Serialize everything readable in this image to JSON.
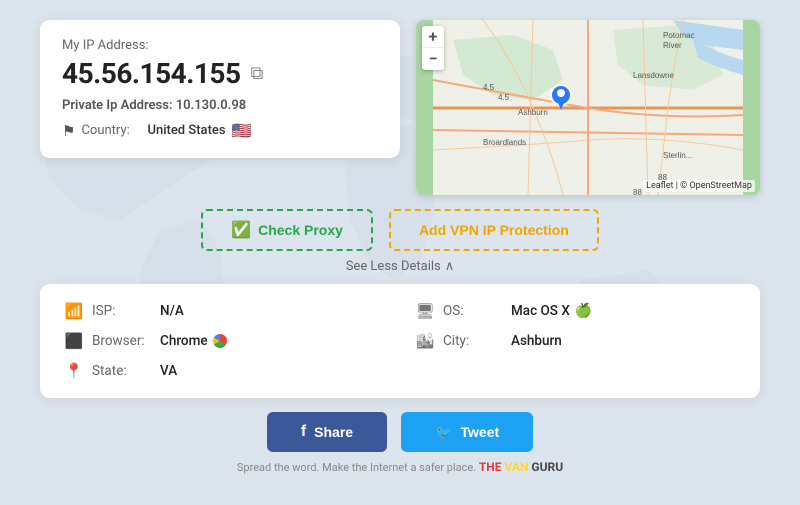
{
  "header": {
    "ip_label": "My IP Address:",
    "ip_address": "45.56.154.155",
    "private_ip_label": "Private Ip Address:",
    "private_ip": "10.130.0.98",
    "country_label": "Country:",
    "country_name": "United States",
    "copy_tooltip": "Copy"
  },
  "map": {
    "zoom_in": "+",
    "zoom_out": "−",
    "attribution": "Leaflet | © OpenStreetMap"
  },
  "buttons": {
    "check_proxy": "Check Proxy",
    "add_vpn": "Add VPN IP Protection",
    "see_less": "See Less Details",
    "chevron": "∧"
  },
  "details": {
    "isp_label": "ISP:",
    "isp_value": "N/A",
    "os_label": "OS:",
    "os_value": "Mac OS X",
    "browser_label": "Browser:",
    "browser_value": "Chrome",
    "city_label": "City:",
    "city_value": "Ashburn",
    "state_label": "State:",
    "state_value": "VA"
  },
  "share": {
    "share_label": "Share",
    "tweet_label": "Tweet"
  },
  "footer": {
    "text": "Spread the word. Make the Internet a safer place.",
    "brand": "THE VAN GURU"
  }
}
